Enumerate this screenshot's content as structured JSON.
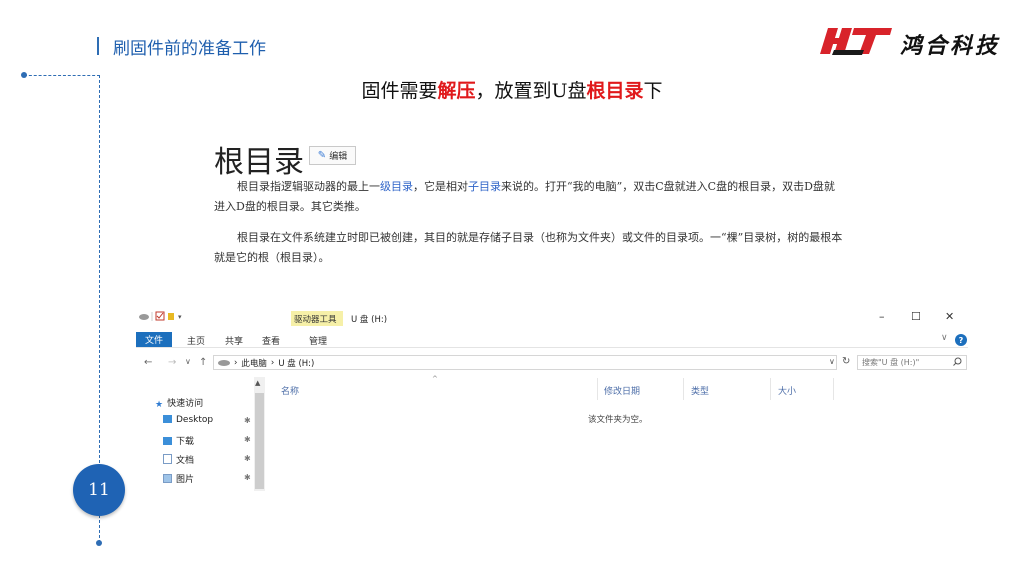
{
  "header": {
    "title": "刷固件前的准备工作",
    "logo_mark": "HT",
    "logo_text": "鸿合科技"
  },
  "instruction": {
    "part1": "固件需要",
    "emph1": "解压",
    "part2": "，放置到U盘",
    "emph2": "根目录",
    "part3": "下"
  },
  "wiki": {
    "title": "根目录",
    "edit_label": "编辑",
    "para1": {
      "t1": "根目录指逻辑驱动器的最上一",
      "link1": "级目录",
      "t2": "，它是相对",
      "link2": "子目录",
      "t3": "来说的。打开“我的电脑”，双击C盘就进入C盘的根目录，双击D盘就进入D盘的根目录。其它类推。"
    },
    "para2": "根目录在文件系统建立时即已被创建，其目的就是存储子目录（也称为文件夹）或文件的目录项。一“棵”目录树，树的最根本就是它的根（根目录）。"
  },
  "explorer": {
    "quick_toolbar": "▾",
    "tool_tab": "驱动器工具",
    "window_title": "U 盘 (H:)",
    "controls": {
      "minimize": "–",
      "maximize": "☐",
      "close": "✕"
    },
    "ribbon_tabs": [
      "文件",
      "主页",
      "共享",
      "查看",
      "管理"
    ],
    "expand": "∨",
    "help": "?",
    "nav": {
      "back": "←",
      "forward": "→",
      "recent": "∨",
      "up": "↑"
    },
    "address": {
      "sep1": "›",
      "pc": "此电脑",
      "sep2": "›",
      "drive": "U 盘 (H:)"
    },
    "refresh": "↻",
    "search_placeholder": "搜索\"U 盘 (H:)\"",
    "nav_pane": [
      {
        "label": "快速访问"
      },
      {
        "label": "Desktop"
      },
      {
        "label": "下载"
      },
      {
        "label": "文档"
      },
      {
        "label": "图片"
      }
    ],
    "pin_glyph": "✱",
    "columns": [
      "名称",
      "修改日期",
      "类型",
      "大小"
    ],
    "empty_text": "该文件夹为空。"
  },
  "page_number": "11",
  "colors": {
    "accent": "#1f63b4",
    "emphasis": "#e0191b",
    "logo_red": "#d8232a"
  }
}
